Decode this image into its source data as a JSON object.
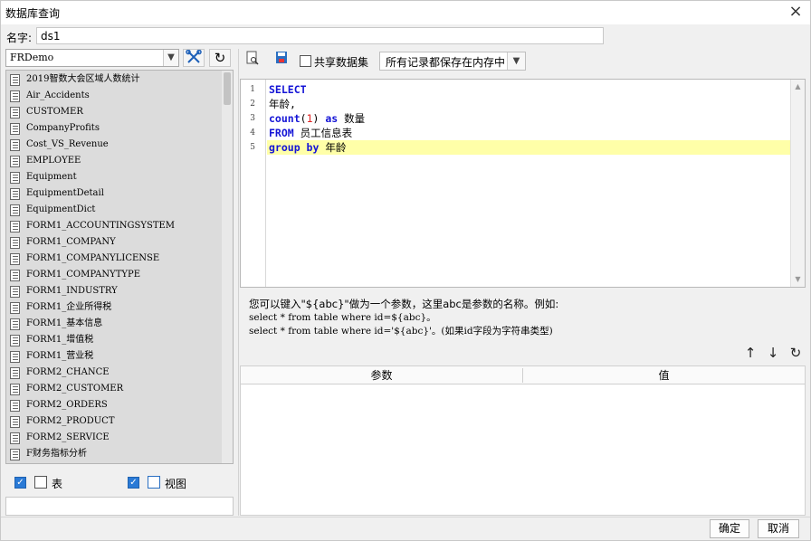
{
  "window": {
    "title": "数据库查询",
    "close_icon": "×"
  },
  "name_field": {
    "label": "名字:",
    "value": "ds1"
  },
  "left": {
    "db_select_value": "FRDemo",
    "tools": {
      "settings_icon": "✂",
      "refresh_icon": "↻"
    },
    "tables": [
      "2019智数大会区域人数统计",
      "Air_Accidents",
      "CUSTOMER",
      "CompanyProfits",
      "Cost_VS_Revenue",
      "EMPLOYEE",
      "Equipment",
      "EquipmentDetail",
      "EquipmentDict",
      "FORM1_ACCOUNTINGSYSTEM",
      "FORM1_COMPANY",
      "FORM1_COMPANYLICENSE",
      "FORM1_COMPANYTYPE",
      "FORM1_INDUSTRY",
      "FORM1_企业所得税",
      "FORM1_基本信息",
      "FORM1_增值税",
      "FORM1_营业税",
      "FORM2_CHANCE",
      "FORM2_CUSTOMER",
      "FORM2_ORDERS",
      "FORM2_PRODUCT",
      "FORM2_SERVICE",
      "F财务指标分析"
    ],
    "filters": {
      "table_label": "表",
      "view_label": "视图"
    }
  },
  "right": {
    "shared_dataset_label": "共享数据集",
    "save_mode": "所有记录都保存在内存中",
    "sql_lines": [
      {
        "no": "1",
        "tokens": [
          {
            "t": "SELECT",
            "c": "kw"
          }
        ]
      },
      {
        "no": "2",
        "tokens": [
          {
            "t": "年龄,",
            "c": ""
          }
        ]
      },
      {
        "no": "3",
        "tokens": [
          {
            "t": "count",
            "c": "kw"
          },
          {
            "t": "(",
            "c": ""
          },
          {
            "t": "1",
            "c": "num"
          },
          {
            "t": ")",
            "c": ""
          },
          {
            "t": " as ",
            "c": "kw"
          },
          {
            "t": "数量",
            "c": ""
          }
        ]
      },
      {
        "no": "4",
        "tokens": [
          {
            "t": "FROM",
            "c": "kw"
          },
          {
            "t": " 员工信息表",
            "c": ""
          }
        ]
      },
      {
        "no": "5",
        "tokens": [
          {
            "t": "group by",
            "c": "kw"
          },
          {
            "t": " 年龄",
            "c": ""
          }
        ]
      }
    ],
    "hint": {
      "line1": "您可以键入\"${abc}\"做为一个参数，这里abc是参数的名称。例如:",
      "line2": "select * from table where id=${abc}。",
      "line3": "select * from table where id='${abc}'。(如果id字段为字符串类型)"
    },
    "param_tools": {
      "up": "↑",
      "down": "↓",
      "refresh": "↻"
    },
    "param_columns": {
      "param": "参数",
      "value": "值"
    }
  },
  "footer": {
    "ok_label": "确定",
    "cancel_label": "取消"
  }
}
